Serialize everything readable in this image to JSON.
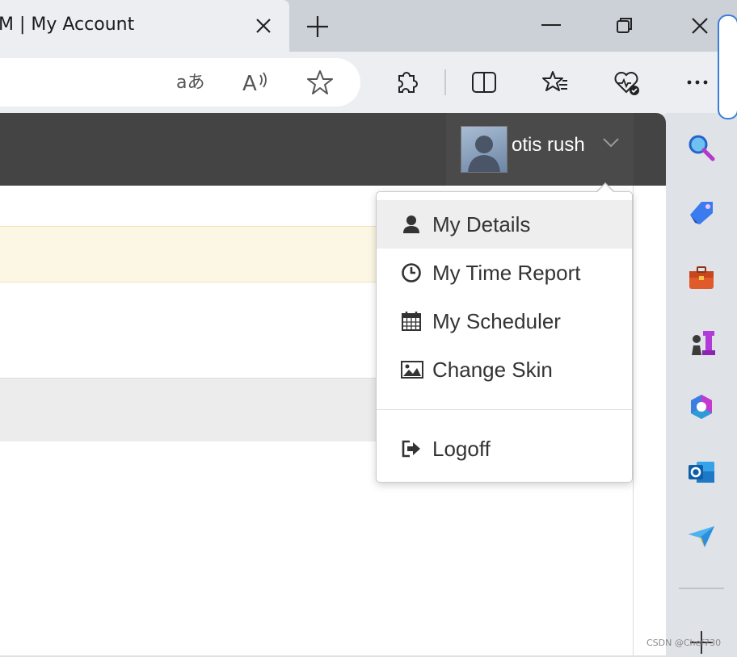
{
  "browser": {
    "tab_title": "M | My Account",
    "address_icons": [
      "translate-icon",
      "read-aloud-icon",
      "favorite-star-icon"
    ],
    "toolbar_icons": [
      "extensions-icon",
      "split-screen-icon",
      "favorites-icon",
      "browser-essentials-icon",
      "more-icon"
    ]
  },
  "app": {
    "user_name": "otis rush",
    "menu": {
      "items": [
        {
          "label": "My Details",
          "icon": "user-icon"
        },
        {
          "label": "My Time Report",
          "icon": "clock-icon"
        },
        {
          "label": "My Scheduler",
          "icon": "calendar-icon"
        },
        {
          "label": "Change Skin",
          "icon": "image-icon"
        }
      ],
      "logoff": {
        "label": "Logoff",
        "icon": "logoff-icon"
      }
    }
  },
  "sidebar": {
    "icons": [
      "search-icon",
      "shopping-tag-icon",
      "tools-icon",
      "games-icon",
      "microsoft-365-icon",
      "outlook-icon",
      "send-icon",
      "add-icon"
    ]
  },
  "watermark": "CSDN @Chef730"
}
